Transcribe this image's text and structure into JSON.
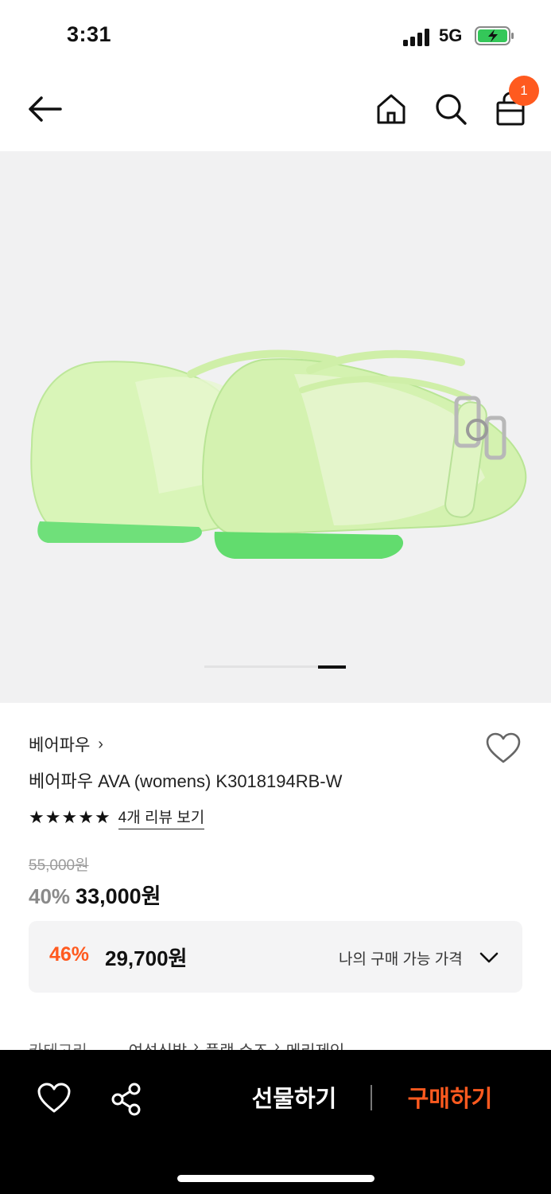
{
  "status": {
    "time": "3:31",
    "network": "5G"
  },
  "header": {
    "cart_count": "1"
  },
  "carousel": {
    "current_index": 2,
    "total": 2
  },
  "product": {
    "brand": "베어파우",
    "brand_chevron": "›",
    "name": "베어파우 AVA (womens) K3018194RB-W",
    "rating_stars": 5,
    "review_link": "4개 리뷰 보기",
    "original_price": "55,000원",
    "discount": "40%",
    "sale_price": "33,000원"
  },
  "my_price": {
    "discount": "46%",
    "price": "29,700원",
    "label": "나의 구매 가능 가격"
  },
  "category": {
    "label": "카테고리",
    "path": [
      "여성신발",
      "›",
      "플랫 슈즈",
      "›",
      "메리제인"
    ]
  },
  "bottom_bar": {
    "gift_label": "선물하기",
    "buy_label": "구매하기"
  },
  "colors": {
    "accent": "#ff5a1f",
    "image_bg": "#f1f1f2",
    "bottom_bar_bg": "#000000"
  },
  "icons": {
    "back": "arrow-left-icon",
    "home": "home-icon",
    "search": "search-icon",
    "cart": "shopping-bag-icon",
    "wish": "heart-icon",
    "share": "share-icon",
    "expand": "chevron-down-icon"
  }
}
